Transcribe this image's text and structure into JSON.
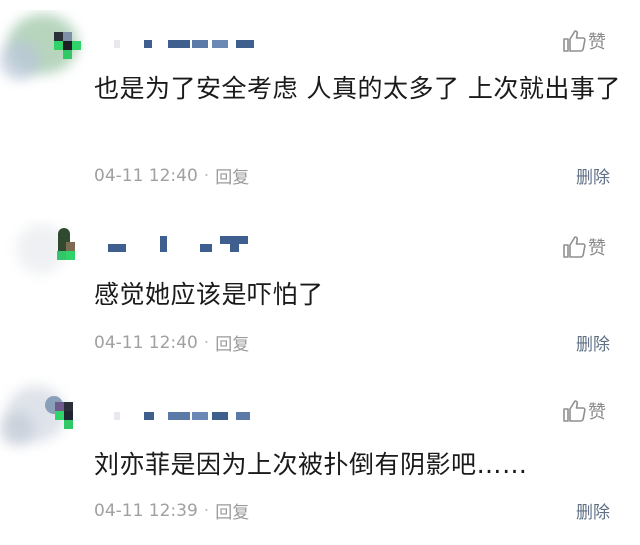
{
  "comments": [
    {
      "content": "也是为了安全考虑 人真的太多了 上次就出事了",
      "time": "04-11 12:40",
      "dot": "·",
      "reply": "回复",
      "like": "赞",
      "delete": "删除"
    },
    {
      "content": "感觉她应该是吓怕了",
      "time": "04-11 12:40",
      "dot": "·",
      "reply": "回复",
      "like": "赞",
      "delete": "删除"
    },
    {
      "content": "刘亦菲是因为上次被扑倒有阴影吧……",
      "time": "04-11 12:39",
      "dot": "·",
      "reply": "回复",
      "like": "赞",
      "delete": "删除"
    }
  ],
  "icons": {
    "like": "thumbs-up-icon"
  },
  "colors": {
    "delete": "#5f6f86",
    "meta": "#a0a0a0",
    "text": "#1a1a1a",
    "pixel_green": "#2fd36a"
  }
}
